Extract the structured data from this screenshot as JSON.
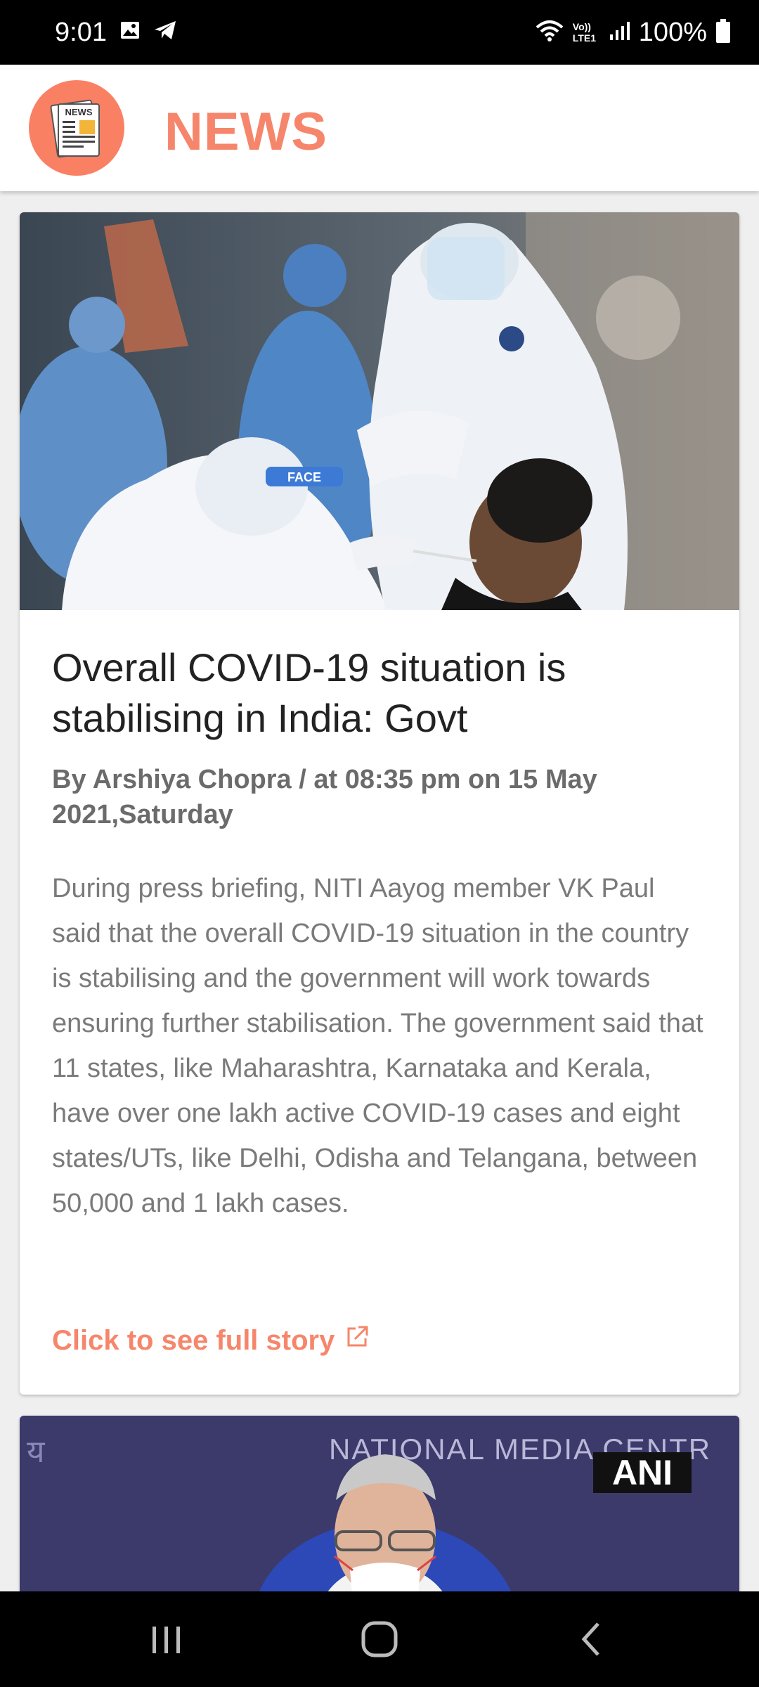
{
  "status_bar": {
    "time": "9:01",
    "network_label": "Vo)) LTE1",
    "battery_percent": "100%",
    "icons": [
      "image-icon",
      "telegram-icon",
      "wifi-icon",
      "signal-icon",
      "battery-icon"
    ]
  },
  "header": {
    "logo_text": "NEWS",
    "title": "NEWS",
    "accent_color": "#f6866b"
  },
  "articles": [
    {
      "title": "Overall COVID-19 situation is stabilising in India: Govt",
      "byline": "By Arshiya Chopra / at 08:35 pm on 15 May 2021,Saturday",
      "summary": "During press briefing, NITI Aayog member VK Paul said that the overall COVID-19 situation in the country is stabilising and the government will work towards ensuring further stabilisation. The government said that 11 states, like Maharashtra, Karnataka and Kerala, have over one lakh active COVID-19 cases and eight states/UTs, like Delhi, Odisha and Telangana, between 50,000 and 1 lakh cases.",
      "link_label": "Click to see full story",
      "image_text": "FACE"
    },
    {
      "image_text_left": "य",
      "image_text_banner": "NATIONAL MEDIA CENTR",
      "image_badge": "ANI"
    }
  ],
  "nav": {
    "icons": [
      "recents-icon",
      "home-icon",
      "back-icon"
    ]
  }
}
